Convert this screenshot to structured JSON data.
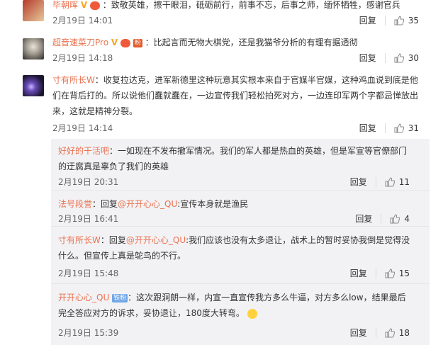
{
  "comments": [
    {
      "name": "毕朝晖",
      "content": "：致敬英雄，擦干眼泪，砥砺前行，前事不忘，后事之师，缅怀牺牲，感谢官兵",
      "time": "2月19日 14:01",
      "reply_label": "回复",
      "likes": "35"
    },
    {
      "name": "超音速菜刀Pro",
      "badge": "粉",
      "content": "：比起言而无物大棋党，还是我猫爷分析的有理有据透彻",
      "time": "2月19日 14:18",
      "reply_label": "回复",
      "likes": "30"
    },
    {
      "name": "寸有所长W",
      "content_line1": "：收复拉达克，进军新德里这种玩意其实根本来自于官媒半官媒，这种鸡血说到底是他",
      "content_line2": "们在背后打的。所以说他们蠢就蠢在，一边宣传我们轻松拍死对方，一边连印军两个字都忌惮放出",
      "content_line3": "来，这就是精神分裂。",
      "time": "2月19日 14:14",
      "reply_label": "回复",
      "likes": "31"
    }
  ],
  "replies": [
    {
      "name": "好好的干活吧",
      "content_line1": "：一如现在不发布撤军情况。我们的军人都是热血的英雄，但是军宣等官僚部门",
      "content_line2": "的迂腐真是辜负了我们的英雄",
      "time": "2月19日 20:31",
      "reply_label": "回复",
      "likes": "11"
    },
    {
      "name": "法号段誉",
      "pre": "：回复",
      "mention": "@开开心心_QU",
      "content": ":宣传本身就是渔民",
      "time": "2月19日 16:41",
      "reply_label": "回复",
      "likes": "4"
    },
    {
      "name": "寸有所长W",
      "pre": "：回复",
      "mention": "@开开心心_QU",
      "content_line1": ":我们应该也没有太多退让，战术上的暂时妥协我倒是觉得没",
      "content_line2": "什么。但宣传上真是鸵鸟的不行。",
      "time": "2月19日 15:48",
      "reply_label": "回复",
      "likes": "15"
    },
    {
      "name": "开开心心_QU",
      "badge": "铁粉",
      "content_line1": "：这次跟洞朗一样，内宣一直宣传我方多么牛逼，对方多么low，结果最后",
      "content_line2": "完全答应对方的诉求，妥协退让，180度大转弯。",
      "time": "2月19日 15:39",
      "reply_label": "回复",
      "likes": "18"
    }
  ]
}
